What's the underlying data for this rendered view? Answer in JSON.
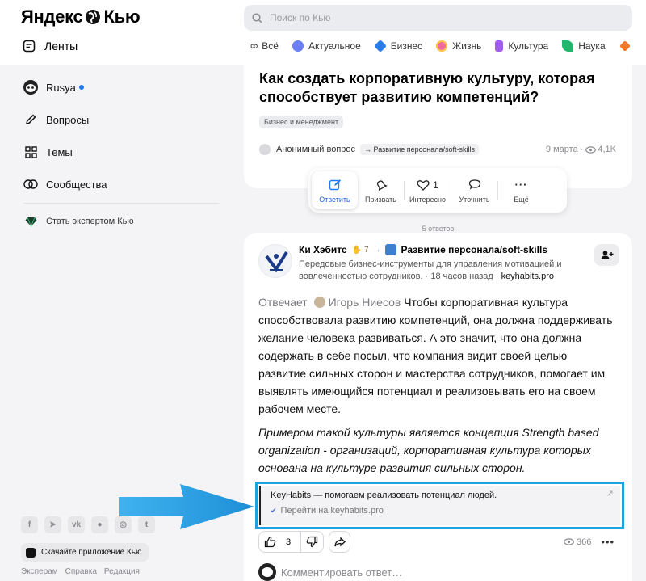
{
  "header": {
    "logo_left": "Яндекс",
    "logo_right": "Кью",
    "search_placeholder": "Поиск по Кью",
    "feeds_label": "Ленты",
    "categories": [
      "Всё",
      "Актуальное",
      "Бизнес",
      "Жизнь",
      "Культура",
      "Наука"
    ],
    "category_colors": [
      "#222222",
      "#6a7ef5",
      "#2b7de9",
      "#f06aa0",
      "#a35cf0",
      "#20b66b"
    ]
  },
  "sidebar": {
    "user_name": "Rusya",
    "items": [
      "Вопросы",
      "Темы",
      "Сообщества"
    ],
    "expert_label": "Стать экспертом Кью",
    "app_button": "Скачайте приложение Кью",
    "footer_links": [
      "Эксперам",
      "Справка",
      "Редакция"
    ],
    "social_icons": [
      "facebook-icon",
      "telegram-icon",
      "vk-icon",
      "ok-icon",
      "instagram-icon",
      "twitter-icon"
    ]
  },
  "question": {
    "title": "Как создать корпоративную культуру, которая способствует развитию компетенций?",
    "tag": "Бизнес и менеджмент",
    "author": "Анонимный вопрос",
    "topic": "Развитие персонала/soft-skills",
    "date": "9 марта",
    "views": "4,1K"
  },
  "actions": [
    {
      "label": "Ответить",
      "icon": "pencil-icon"
    },
    {
      "label": "Призвать",
      "icon": "bell-icon"
    },
    {
      "label": "Интересно",
      "icon": "heart-icon",
      "count": "1"
    },
    {
      "label": "Уточнить",
      "icon": "chat-icon"
    },
    {
      "label": "Ещё",
      "icon": "more-icon"
    }
  ],
  "answers_count": "5 ответов",
  "answer": {
    "author": "Ки Хэбитс",
    "rating": "7",
    "topic": "Развитие персонала/soft-skills",
    "description": "Передовые бизнес-инструменты для управления мотивацией и вовлеченностью сотрудников.",
    "time": "· 18 часов назад ·",
    "site": "keyhabits.pro",
    "answered_label": "Отвечает",
    "answered_by": "Игорь Ниесов",
    "body": "Чтобы корпоративная культура способствовала развитию компетенций, она должна поддерживать желание человека развиваться. А это значит, что она должна содержать в себе посыл, что компания видит своей целью развитие сильных сторон и мастерства сотрудников, помогает им выявлять имеющийся потенциал и реализовывать его на своем рабочем месте.",
    "body_italic": "Примером такой культуры является концепция Strength based organization - организаций, корпоративная культура которых основана на культуре развития сильных сторон.",
    "promo_text": "KeyHabits — помогаем реализовать потенциал людей.",
    "promo_link": "Перейти на keyhabits.pro",
    "likes": "3",
    "views": "366",
    "comment_placeholder": "Комментировать ответ…"
  },
  "colors": {
    "accent": "#1f7bf6",
    "highlight_border": "#1ea1df",
    "annotation_arrow": "#2aa6e6"
  }
}
